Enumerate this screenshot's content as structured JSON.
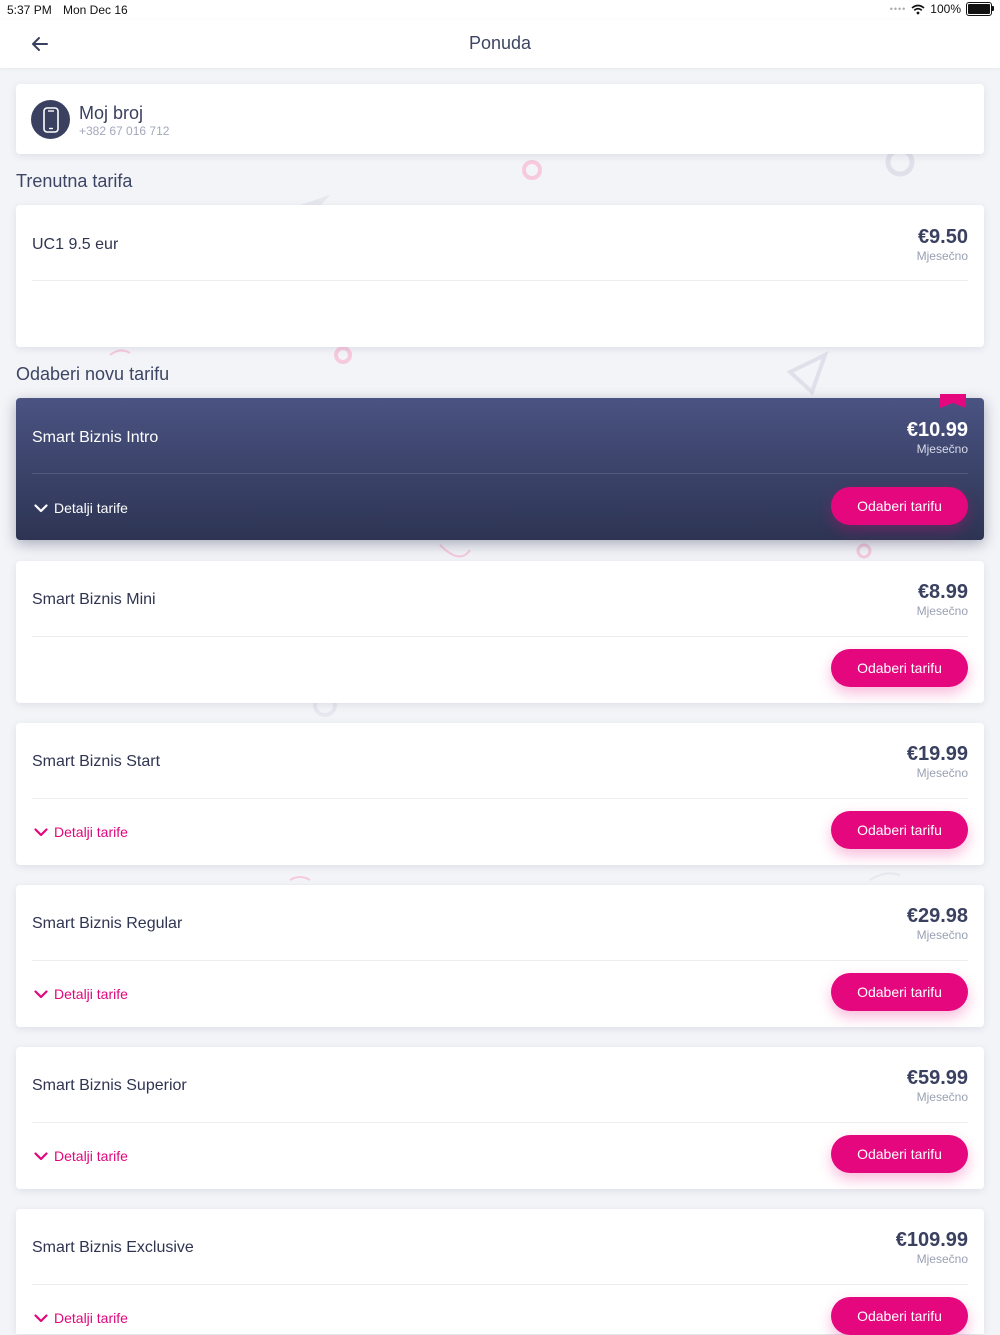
{
  "status_bar": {
    "time": "5:37 PM",
    "date": "Mon Dec 16",
    "battery": "100%"
  },
  "nav": {
    "title": "Ponuda",
    "back_icon": "arrow-left-icon"
  },
  "my_number": {
    "title": "Moj broj",
    "number": "+382 67 016 712",
    "icon": "mobile-phone-icon"
  },
  "current_tariff": {
    "section_title": "Trenutna tarifa",
    "name": "UC1 9.5 eur",
    "price": "€9.50",
    "period": "Mjesečno"
  },
  "new_tariffs": {
    "section_title": "Odaberi novu tarifu",
    "details_label": "Detalji tarife",
    "select_label": "Odaberi tarifu",
    "items": [
      {
        "name": "Smart Biznis Intro",
        "price": "€10.99",
        "period": "Mjesečno"
      },
      {
        "name": "Smart Biznis Mini",
        "price": "€8.99",
        "period": "Mjesečno"
      },
      {
        "name": "Smart Biznis Start",
        "price": "€19.99",
        "period": "Mjesečno"
      },
      {
        "name": "Smart Biznis Regular",
        "price": "€29.98",
        "period": "Mjesečno"
      },
      {
        "name": "Smart Biznis Superior",
        "price": "€59.99",
        "period": "Mjesečno"
      },
      {
        "name": "Smart Biznis Exclusive",
        "price": "€109.99",
        "period": "Mjesečno"
      }
    ]
  },
  "colors": {
    "accent": "#e5077e",
    "featured_top": "#4a5382",
    "featured_bottom": "#2d3453",
    "text_dark": "#2f3551",
    "background": "#f3f4f8"
  }
}
